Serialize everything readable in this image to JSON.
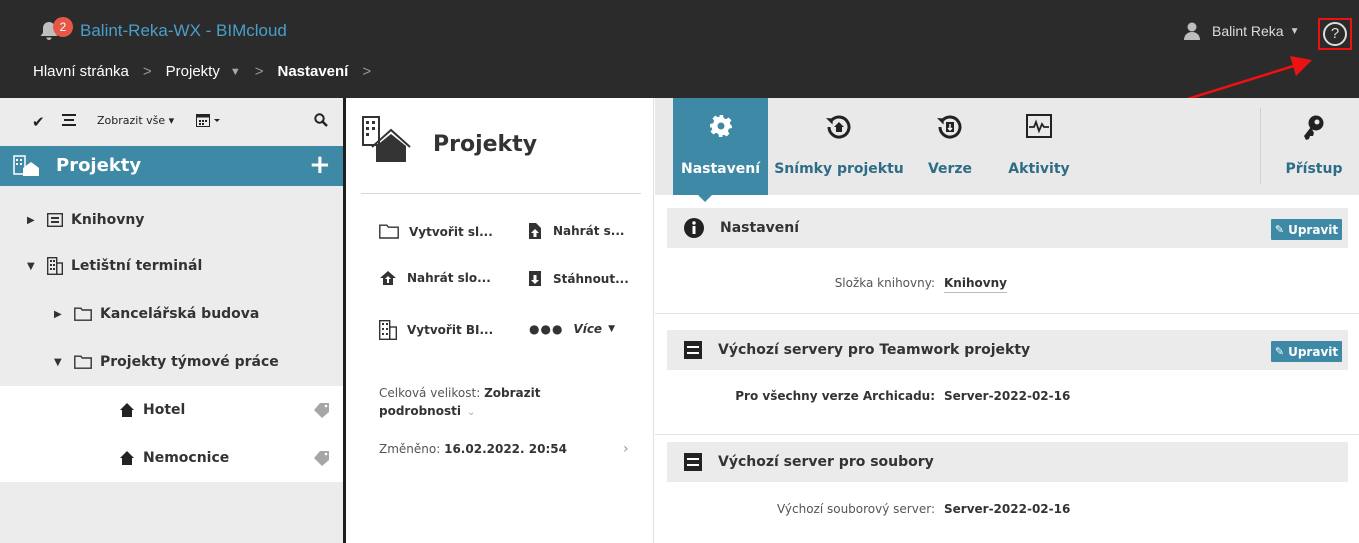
{
  "header": {
    "notification_count": "2",
    "app_title": "Balint-Reka-WX - BIMcloud",
    "breadcrumb": [
      {
        "label": "Hlavní stránka"
      },
      {
        "label": "Projekty"
      },
      {
        "label": "Nastavení"
      }
    ],
    "breadcrumb_sep": ">",
    "user_name": "Balint Reka",
    "help_symbol": "?",
    "highlight_color": "#e11111"
  },
  "sidebar": {
    "filter_label": "Zobrazit vše",
    "section_title": "Projekty",
    "add_symbol": "+",
    "tree": [
      {
        "label": "Knihovny",
        "icon": "library-icon",
        "expanded": false
      },
      {
        "label": "Letištní terminál",
        "icon": "building-icon",
        "expanded": true
      },
      {
        "label": "Kancelářská budova",
        "icon": "folder-icon",
        "expanded": false
      },
      {
        "label": "Projekty týmové práce",
        "icon": "folder-icon",
        "expanded": true
      },
      {
        "label": "Hotel",
        "icon": "project-icon"
      },
      {
        "label": "Nemocnice",
        "icon": "project-icon"
      }
    ]
  },
  "middle": {
    "title": "Projekty",
    "actions": [
      {
        "label": "Vytvořit sl...",
        "icon": "folder-icon"
      },
      {
        "label": "Nahrát s...",
        "icon": "upload-icon"
      },
      {
        "label": "Nahrát slo...",
        "icon": "upload-folder-icon"
      },
      {
        "label": "Stáhnout...",
        "icon": "download-icon"
      },
      {
        "label": "Vytvořit BI...",
        "icon": "building-icon"
      },
      {
        "label": "Více",
        "icon": "more-icon"
      }
    ],
    "size_label": "Celková velikost:",
    "size_value_1": "Zobrazit",
    "size_value_2": "podrobnosti",
    "modified_label": "Změněno:",
    "modified_value": "16.02.2022. 20:54"
  },
  "tabs": [
    {
      "label": "Nastavení",
      "icon": "gear-icon",
      "active": true
    },
    {
      "label": "Snímky projektu",
      "icon": "snapshot-icon"
    },
    {
      "label": "Verze",
      "icon": "versions-icon"
    },
    {
      "label": "Aktivity",
      "icon": "activity-icon"
    },
    {
      "label": "Přístup",
      "icon": "key-icon"
    }
  ],
  "sections": [
    {
      "title": "Nastavení",
      "icon": "info-icon",
      "edit_label": "Upravit",
      "prop_label": "Složka knihovny:",
      "prop_value": "Knihovny"
    },
    {
      "title": "Výchozí servery pro Teamwork projekty",
      "icon": "server-icon",
      "edit_label": "Upravit",
      "prop_label": "Pro všechny verze Archicadu:",
      "prop_value": "Server-2022-02-16"
    },
    {
      "title": "Výchozí server pro soubory",
      "icon": "server-icon",
      "prop_label": "Výchozí souborový server:",
      "prop_value": "Server-2022-02-16"
    }
  ],
  "colors": {
    "accent": "#3e8aa6",
    "header_bg": "#2b2b2b",
    "title_blue": "#4a9fc9",
    "badge": "#e65845"
  }
}
